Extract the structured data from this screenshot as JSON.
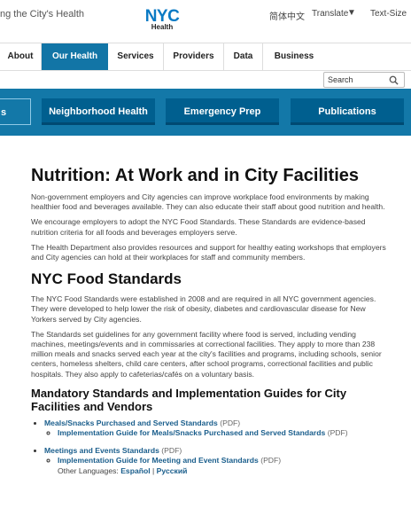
{
  "header": {
    "tagline": "ng the City's Health",
    "logo": {
      "top": "NYC",
      "bottom": "Health"
    },
    "language": "简体中文",
    "translate": "Translate",
    "translate_caret": "▼",
    "text_size": "Text-Size"
  },
  "nav": [
    "About",
    "Our Health",
    "Services",
    "Providers",
    "Data",
    "Business"
  ],
  "nav_active": "Our Health",
  "search": {
    "placeholder": "Search",
    "icon": "search-icon"
  },
  "band": [
    "s",
    "Neighborhood Health",
    "Emergency Prep",
    "Publications"
  ],
  "page": {
    "title": "Nutrition: At Work and in City Facilities",
    "p1": "Non-government employers and City agencies can improve workplace food environments by making healthier food and beverages available. They can also educate their staff about good nutrition and health.",
    "p2": "We encourage employers to adopt the NYC Food Standards. These Standards are evidence-based nutrition criteria for all foods and beverages employers serve.",
    "p3": "The Health Department also provides resources and support for healthy eating workshops that employers and City agencies can hold at their workplaces for staff and community members.",
    "h2": "NYC Food Standards",
    "p4": "The NYC Food Standards were established in 2008 and are required in all NYC government agencies. They were developed to help lower the risk of obesity, diabetes and cardiovascular disease for New Yorkers served by City agencies.",
    "p5": "The Standards set guidelines for any government facility where food is served, including vending machines, meetings/events and in commissaries at correctional facilities. They apply to more than 238 million meals and snacks served each year at the city's facilities and programs, including schools, senior centers, homeless shelters, child care centers, after school programs, correctional facilities and public hospitals. They also apply to cafeterias/cafés on a voluntary basis.",
    "h3": "Mandatory Standards and Implementation Guides for City Facilities and Vendors",
    "links": {
      "meals": "Meals/Snacks Purchased and Served Standards",
      "meals_guide": "Implementation Guide for Meals/Snacks Purchased and Served Standards",
      "meetings": "Meetings and Events Standards",
      "meetings_guide": "Implementation Guide for Meeting and Event Standards",
      "pdf": "(PDF)",
      "other_languages": "Other Languages:",
      "espanol": "Español",
      "separator": "|",
      "russian": "Русский"
    }
  },
  "colors": {
    "brand_blue": "#1275a6",
    "band_blue": "#1378a8",
    "link": "#1a5e8c"
  }
}
